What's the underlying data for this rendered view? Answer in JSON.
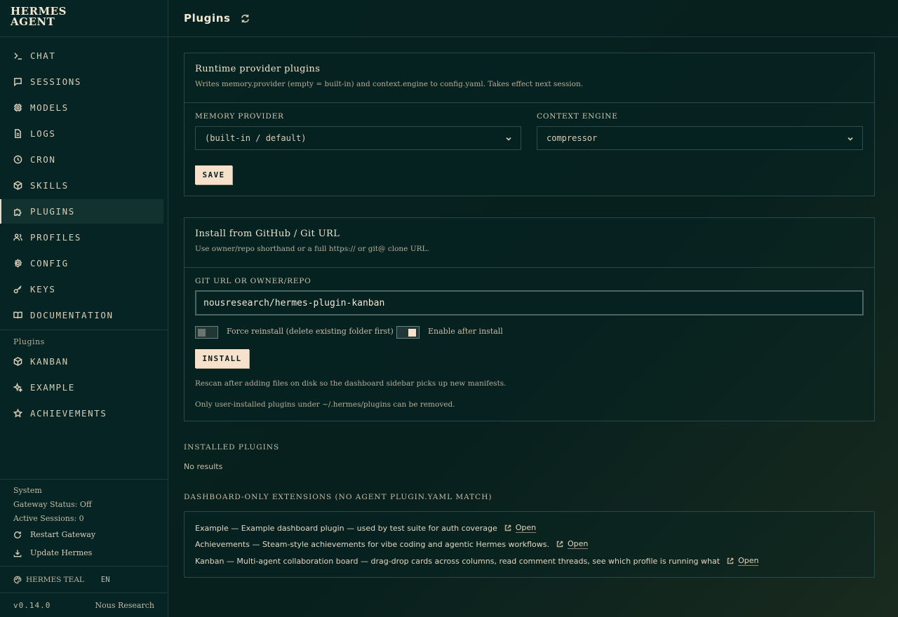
{
  "app": {
    "logo_line1": "HERMES",
    "logo_line2": "AGENT"
  },
  "sidebar": {
    "items": [
      {
        "label": "CHAT",
        "icon": "terminal-icon"
      },
      {
        "label": "SESSIONS",
        "icon": "message-square-icon"
      },
      {
        "label": "MODELS",
        "icon": "cpu-icon"
      },
      {
        "label": "LOGS",
        "icon": "file-text-icon"
      },
      {
        "label": "CRON",
        "icon": "clock-icon"
      },
      {
        "label": "SKILLS",
        "icon": "package-icon"
      },
      {
        "label": "PLUGINS",
        "icon": "puzzle-icon",
        "active": true
      },
      {
        "label": "PROFILES",
        "icon": "users-icon"
      },
      {
        "label": "CONFIG",
        "icon": "settings-icon"
      },
      {
        "label": "KEYS",
        "icon": "key-icon"
      },
      {
        "label": "DOCUMENTATION",
        "icon": "book-open-icon"
      }
    ],
    "plugins_heading": "Plugins",
    "plugin_items": [
      {
        "label": "KANBAN",
        "icon": "package-icon"
      },
      {
        "label": "EXAMPLE",
        "icon": "sparkles-icon"
      },
      {
        "label": "ACHIEVEMENTS",
        "icon": "star-icon"
      }
    ],
    "system": {
      "heading": "System",
      "gateway_status": "Gateway Status: Off",
      "active_sessions": "Active Sessions: 0",
      "restart_label": "Restart Gateway",
      "update_label": "Update Hermes"
    },
    "theme": "HERMES TEAL",
    "language": "EN",
    "version": "v0.14.0",
    "vendor": "Nous Research"
  },
  "header": {
    "title": "Plugins"
  },
  "runtime": {
    "title": "Runtime provider plugins",
    "subtitle": "Writes memory.provider (empty = built-in) and context.engine to config.yaml. Takes effect next session.",
    "memory_label": "MEMORY PROVIDER",
    "memory_value": "(built-in / default)",
    "context_label": "CONTEXT ENGINE",
    "context_value": "compressor",
    "save_label": "SAVE"
  },
  "install": {
    "title": "Install from GitHub / Git URL",
    "subtitle": "Use owner/repo shorthand or a full https:// or git@ clone URL.",
    "url_label": "GIT URL OR OWNER/REPO",
    "url_value": "nousresearch/hermes-plugin-kanban",
    "force_label": "Force reinstall (delete existing folder first)",
    "force_on": false,
    "enable_label": "Enable after install",
    "enable_on": true,
    "install_label": "INSTALL",
    "note1": "Rescan after adding files on disk so the dashboard sidebar picks up new manifests.",
    "note2": "Only user-installed plugins under ~/.hermes/plugins can be removed."
  },
  "installed": {
    "heading": "INSTALLED PLUGINS",
    "empty": "No results"
  },
  "extensions": {
    "heading": "DASHBOARD-ONLY EXTENSIONS (NO AGENT PLUGIN.YAML MATCH)",
    "open_label": "Open",
    "rows": [
      "Example — Example dashboard plugin — used by test suite for auth coverage",
      "Achievements — Steam-style achievements for vibe coding and agentic Hermes workflows.",
      "Kanban — Multi-agent collaboration board — drag-drop cards across columns, read comment threads, see which profile is running what"
    ]
  }
}
